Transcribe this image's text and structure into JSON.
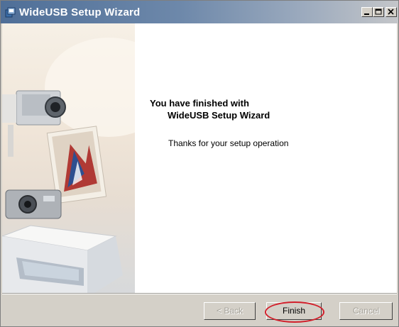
{
  "window": {
    "title": "WideUSB Setup Wizard"
  },
  "main": {
    "heading_line1": "You have finished with",
    "heading_line2": "WideUSB Setup Wizard",
    "message": "Thanks for your setup operation"
  },
  "buttons": {
    "back": "< Back",
    "finish": "Finish",
    "cancel": "Cancel"
  },
  "colors": {
    "accent_circle": "#d21f2b",
    "titlebar_start": "#4f6f98",
    "dialog_face": "#d4d0c8"
  },
  "icons": {
    "app": "setup-app-icon",
    "minimize": "minimize-icon",
    "maximize": "maximize-icon",
    "close": "close-icon"
  }
}
